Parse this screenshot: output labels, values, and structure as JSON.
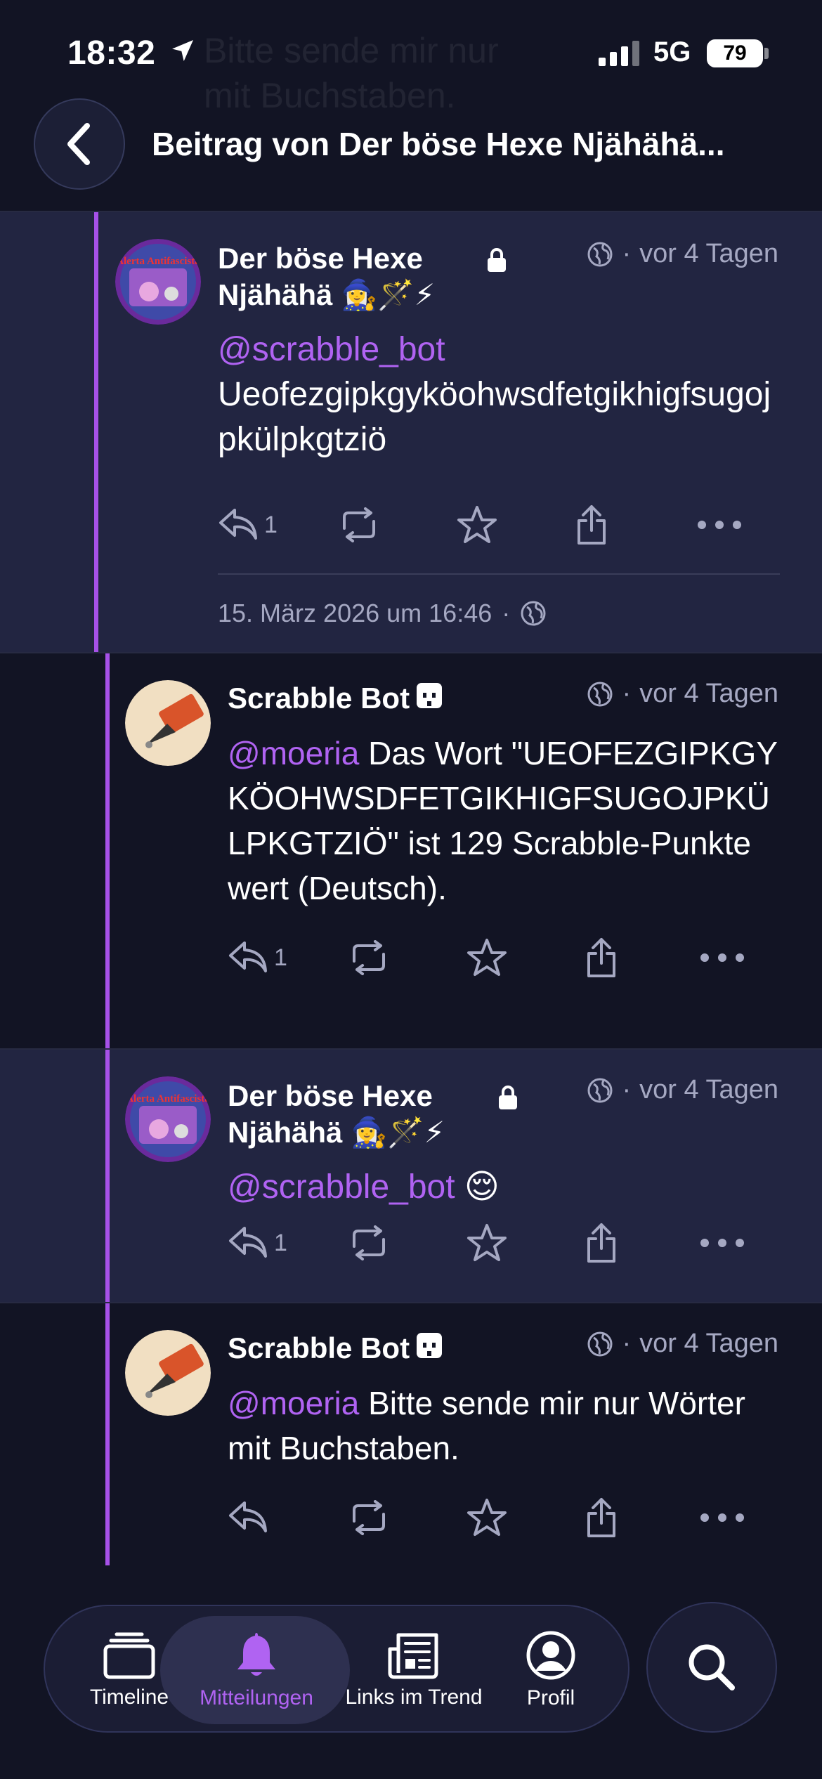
{
  "status_bar": {
    "time": "18:32",
    "network": "5G",
    "battery": "79"
  },
  "header": {
    "title": "Beitrag von Der böse Hexe Njähähä..."
  },
  "ghost": {
    "line1": "Bitte sende mir nur",
    "line2": "mit Buchstaben."
  },
  "posts": [
    {
      "display_name": "Der böse Hexe Njähähä 🧙‍♀️🪄⚡",
      "time": "vor 4 Tagen",
      "mention": "@scrabble_bot",
      "text": "Ueofezgipkgyköohwsdfetgikhigfsugojpkülpkgtziö",
      "reply_count": "1",
      "date": "15. März 2026 um 16:46",
      "avatar_text": "Alerta Antifascista"
    },
    {
      "display_name": "Scrabble Bot",
      "time": "vor 4 Tagen",
      "mention": "@moeria",
      "text": " Das Wort \"UEOFEZGIPKGYKÖOHWSDFETGIKHIGFSUGOJPKÜLPKGTZIÖ\" ist 129 Scrabble-Punkte wert (Deutsch).",
      "reply_count": "1"
    },
    {
      "display_name": "Der böse Hexe Njähähä 🧙‍♀️🪄⚡",
      "time": "vor 4 Tagen",
      "mention": "@scrabble_bot",
      "text": " 😌",
      "reply_count": "1",
      "avatar_text": "Alerta Antifascista"
    },
    {
      "display_name": "Scrabble Bot",
      "time": "vor 4 Tagen",
      "mention": "@moeria",
      "text": " Bitte sende mir nur Wörter mit Buchstaben.",
      "reply_count": ""
    }
  ],
  "tabs": [
    {
      "label": "Timeline",
      "icon": "stack-icon"
    },
    {
      "label": "Mitteilungen",
      "icon": "bell-icon",
      "active": true
    },
    {
      "label": "Links im Trend",
      "icon": "newspaper-icon"
    },
    {
      "label": "Profil",
      "icon": "person-circle-icon"
    }
  ],
  "colors": {
    "accent": "#b063f2",
    "background": "#121424",
    "highlight": "#222541",
    "secondary_text": "#a5a8c2"
  }
}
